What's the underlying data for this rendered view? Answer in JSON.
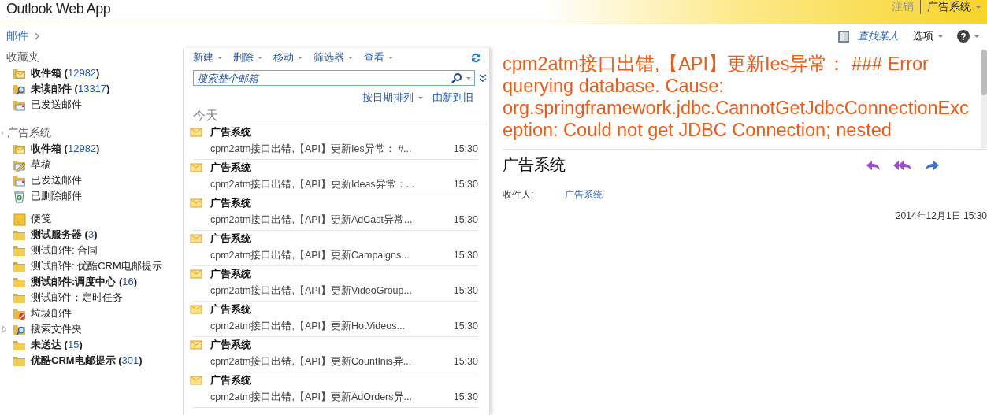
{
  "header": {
    "logo": "Outlook Web App",
    "sign_out": "注销",
    "account": "广告系统"
  },
  "nav_bar": {
    "breadcrumb": "邮件",
    "find_someone": "查找某人",
    "options": "选项",
    "help": "?"
  },
  "folder_groups": [
    {
      "title": "收藏夹",
      "expander": false,
      "folders": [
        {
          "kind": "inbox",
          "name": "收件箱",
          "count": "(12982)",
          "expandable": false
        },
        {
          "kind": "search",
          "name": "未读邮件",
          "count": "(13317)",
          "expandable": false
        },
        {
          "kind": "sent",
          "name": "已发送邮件",
          "expandable": false
        }
      ]
    },
    {
      "title": "广告系统",
      "expander": true,
      "folders": [
        {
          "kind": "inbox",
          "name": "收件箱",
          "count": "(12982)",
          "expandable": false
        },
        {
          "kind": "drafts",
          "name": "草稿",
          "expandable": false
        },
        {
          "kind": "sent",
          "name": "已发送邮件",
          "expandable": false
        },
        {
          "kind": "deleted",
          "name": "已删除邮件",
          "expandable": false
        },
        {
          "kind": "notes",
          "name": "便笺",
          "expandable": false
        },
        {
          "kind": "folder",
          "name": "测试服务器",
          "count": "(3)",
          "expandable": false
        },
        {
          "kind": "folder",
          "name": "测试邮件: 合同",
          "expandable": false
        },
        {
          "kind": "folder",
          "name": "测试邮件: 优酷CRM电邮提示",
          "expandable": false
        },
        {
          "kind": "folder",
          "name": "测试邮件:调度中心",
          "count": "(16)",
          "expandable": false
        },
        {
          "kind": "folder",
          "name": "测试邮件：定时任务",
          "expandable": false
        },
        {
          "kind": "junk",
          "name": "垃圾邮件",
          "expandable": false
        },
        {
          "kind": "search",
          "name": "搜索文件夹",
          "expandable": true
        },
        {
          "kind": "folder",
          "name": "未送达",
          "count": "(15)",
          "expandable": false
        },
        {
          "kind": "folder",
          "name": "优酷CRM电邮提示",
          "count": "(301)",
          "expandable": false
        }
      ]
    }
  ],
  "toolbar": [
    "新建",
    "删除",
    "移动",
    "筛选器",
    "查看"
  ],
  "search": {
    "placeholder": "搜索整个邮箱"
  },
  "sort": {
    "by": "按日期排列",
    "order": "由新到旧"
  },
  "message_group": "今天",
  "messages": [
    {
      "sender": "广告系统",
      "preview": "cpm2atm接口出错,【API】更新Ies异常： #...",
      "time": "15:30"
    },
    {
      "sender": "广告系统",
      "preview": "cpm2atm接口出错,【API】更新Ideas异常：...",
      "time": "15:30"
    },
    {
      "sender": "广告系统",
      "preview": "cpm2atm接口出错,【API】更新AdCast异常...",
      "time": "15:30"
    },
    {
      "sender": "广告系统",
      "preview": "cpm2atm接口出错,【API】更新Campaigns...",
      "time": "15:30"
    },
    {
      "sender": "广告系统",
      "preview": "cpm2atm接口出错,【API】更新VideoGroup...",
      "time": "15:30"
    },
    {
      "sender": "广告系统",
      "preview": "cpm2atm接口出错,【API】更新HotVideos...",
      "time": "15:30"
    },
    {
      "sender": "广告系统",
      "preview": "cpm2atm接口出错,【API】更新CountInis异...",
      "time": "15:30"
    },
    {
      "sender": "广告系统",
      "preview": "cpm2atm接口出错,【API】更新AdOrders异...",
      "time": "15:30"
    }
  ],
  "reading_pane": {
    "subject": "cpm2atm接口出错,【API】更新Ies异常： ### Error querying database. Cause: org.springframework.jdbc.CannotGetJdbcConnectionException: Could not get JDBC Connection; nested",
    "sender": "广告系统",
    "to_label": "收件人:",
    "to": "广告系统",
    "date": "2014年12月1日 15:30"
  }
}
